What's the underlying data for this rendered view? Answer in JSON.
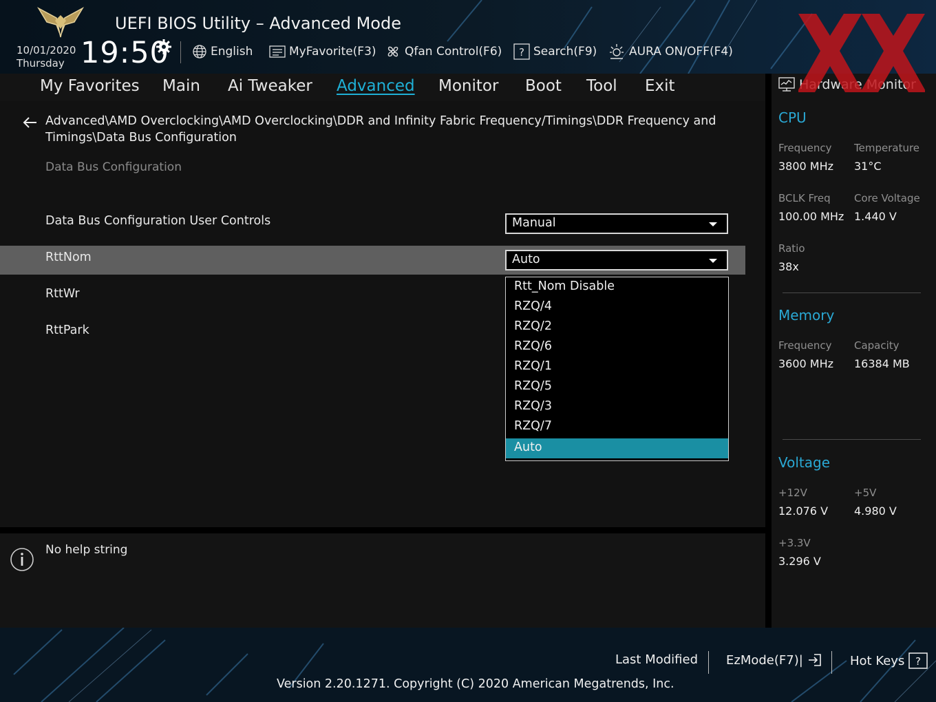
{
  "header": {
    "title": "UEFI BIOS Utility – Advanced Mode",
    "date": "10/01/2020",
    "day": "Thursday",
    "time": "19:50",
    "items": [
      {
        "label": "English",
        "icon": "globe-icon"
      },
      {
        "label": "MyFavorite(F3)",
        "icon": "favorite-list-icon"
      },
      {
        "label": "Qfan Control(F6)",
        "icon": "fan-icon"
      },
      {
        "label": "Search(F9)",
        "icon": "search-help-icon"
      },
      {
        "label": "AURA ON/OFF(F4)",
        "icon": "aura-light-icon"
      }
    ]
  },
  "nav": {
    "tabs": [
      "My Favorites",
      "Main",
      "Ai Tweaker",
      "Advanced",
      "Monitor",
      "Boot",
      "Tool",
      "Exit"
    ],
    "active": "Advanced"
  },
  "main": {
    "breadcrumb": "Advanced\\AMD Overclocking\\AMD Overclocking\\DDR and Infinity Fabric Frequency/Timings\\DDR Frequency and Timings\\Data Bus Configuration",
    "subtitle": "Data Bus Configuration",
    "rows": [
      {
        "label": "Data Bus Configuration User Controls",
        "value": "Manual"
      },
      {
        "label": "RttNom",
        "value": "Auto"
      },
      {
        "label": "RttWr"
      },
      {
        "label": "RttPark"
      }
    ],
    "dropdown": {
      "options": [
        "Rtt_Nom Disable",
        "RZQ/4",
        "RZQ/2",
        "RZQ/6",
        "RZQ/1",
        "RZQ/5",
        "RZQ/3",
        "RZQ/7",
        "Auto"
      ],
      "selected": "Auto"
    }
  },
  "help": {
    "text": "No help string"
  },
  "hw_monitor": {
    "title": "Hardware Monitor",
    "cpu": {
      "title": "CPU",
      "frequency_label": "Frequency",
      "frequency": "3800 MHz",
      "temperature_label": "Temperature",
      "temperature": "31°C",
      "bclk_label": "BCLK Freq",
      "bclk": "100.00 MHz",
      "core_voltage_label": "Core Voltage",
      "core_voltage": "1.440 V",
      "ratio_label": "Ratio",
      "ratio": "38x"
    },
    "memory": {
      "title": "Memory",
      "frequency_label": "Frequency",
      "frequency": "3600 MHz",
      "capacity_label": "Capacity",
      "capacity": "16384 MB"
    },
    "voltage": {
      "title": "Voltage",
      "v12_label": "+12V",
      "v12": "12.076 V",
      "v5_label": "+5V",
      "v5": "4.980 V",
      "v33_label": "+3.3V",
      "v33": "3.296 V"
    }
  },
  "footer": {
    "last_modified": "Last Modified",
    "ezmode": "EzMode(F7)|",
    "hotkeys": "Hot Keys",
    "version": "Version 2.20.1271. Copyright (C) 2020 American Megatrends, Inc."
  },
  "colors": {
    "accent": "#1fb0d6",
    "selected": "#1a8fa3",
    "watermark": "#c0151b"
  }
}
